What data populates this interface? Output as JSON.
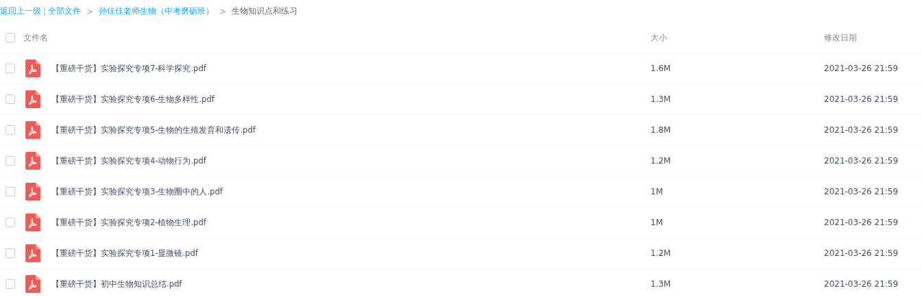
{
  "breadcrumb": [
    {
      "kind": "link",
      "text": "返回上一级"
    },
    {
      "kind": "sep",
      "text": "|"
    },
    {
      "kind": "link",
      "text": "全部文件"
    },
    {
      "kind": "sep",
      "text": ">"
    },
    {
      "kind": "link",
      "text": "孙佳佳老师生物（中考磨砺班）"
    },
    {
      "kind": "sep",
      "text": ">"
    },
    {
      "kind": "current",
      "text": "生物知识点和练习"
    }
  ],
  "table": {
    "select_all": {
      "checked": false
    },
    "columns": [
      "文件名",
      "大小",
      "修改日期"
    ],
    "rows": [
      {
        "checked": false,
        "name": "【重磅干货】实验探究专项7-科学探究.pdf",
        "size": "1.6M",
        "modified": "2021-03-26 21:59"
      },
      {
        "checked": false,
        "name": "【重磅干货】实验探究专项6-生物多样性.pdf",
        "size": "1.3M",
        "modified": "2021-03-26 21:59"
      },
      {
        "checked": false,
        "name": "【重磅干货】实验探究专项5-生物的生殖发育和遗传.pdf",
        "size": "1.8M",
        "modified": "2021-03-26 21:59"
      },
      {
        "checked": false,
        "name": "【重磅干货】实验探究专项4-动物行为.pdf",
        "size": "1.2M",
        "modified": "2021-03-26 21:59"
      },
      {
        "checked": false,
        "name": "【重磅干货】实验探究专项3-生物圈中的人.pdf",
        "size": "1M",
        "modified": "2021-03-26 21:59"
      },
      {
        "checked": false,
        "name": "【重磅干货】实验探究专项2-植物生理.pdf",
        "size": "1M",
        "modified": "2021-03-26 21:59"
      },
      {
        "checked": false,
        "name": "【重磅干货】实验探究专项1-显微镜.pdf",
        "size": "1.2M",
        "modified": "2021-03-26 21:59"
      },
      {
        "checked": false,
        "name": "【重磅干货】初中生物知识总结.pdf",
        "size": "1.3M",
        "modified": "2021-03-26 21:59"
      }
    ]
  }
}
